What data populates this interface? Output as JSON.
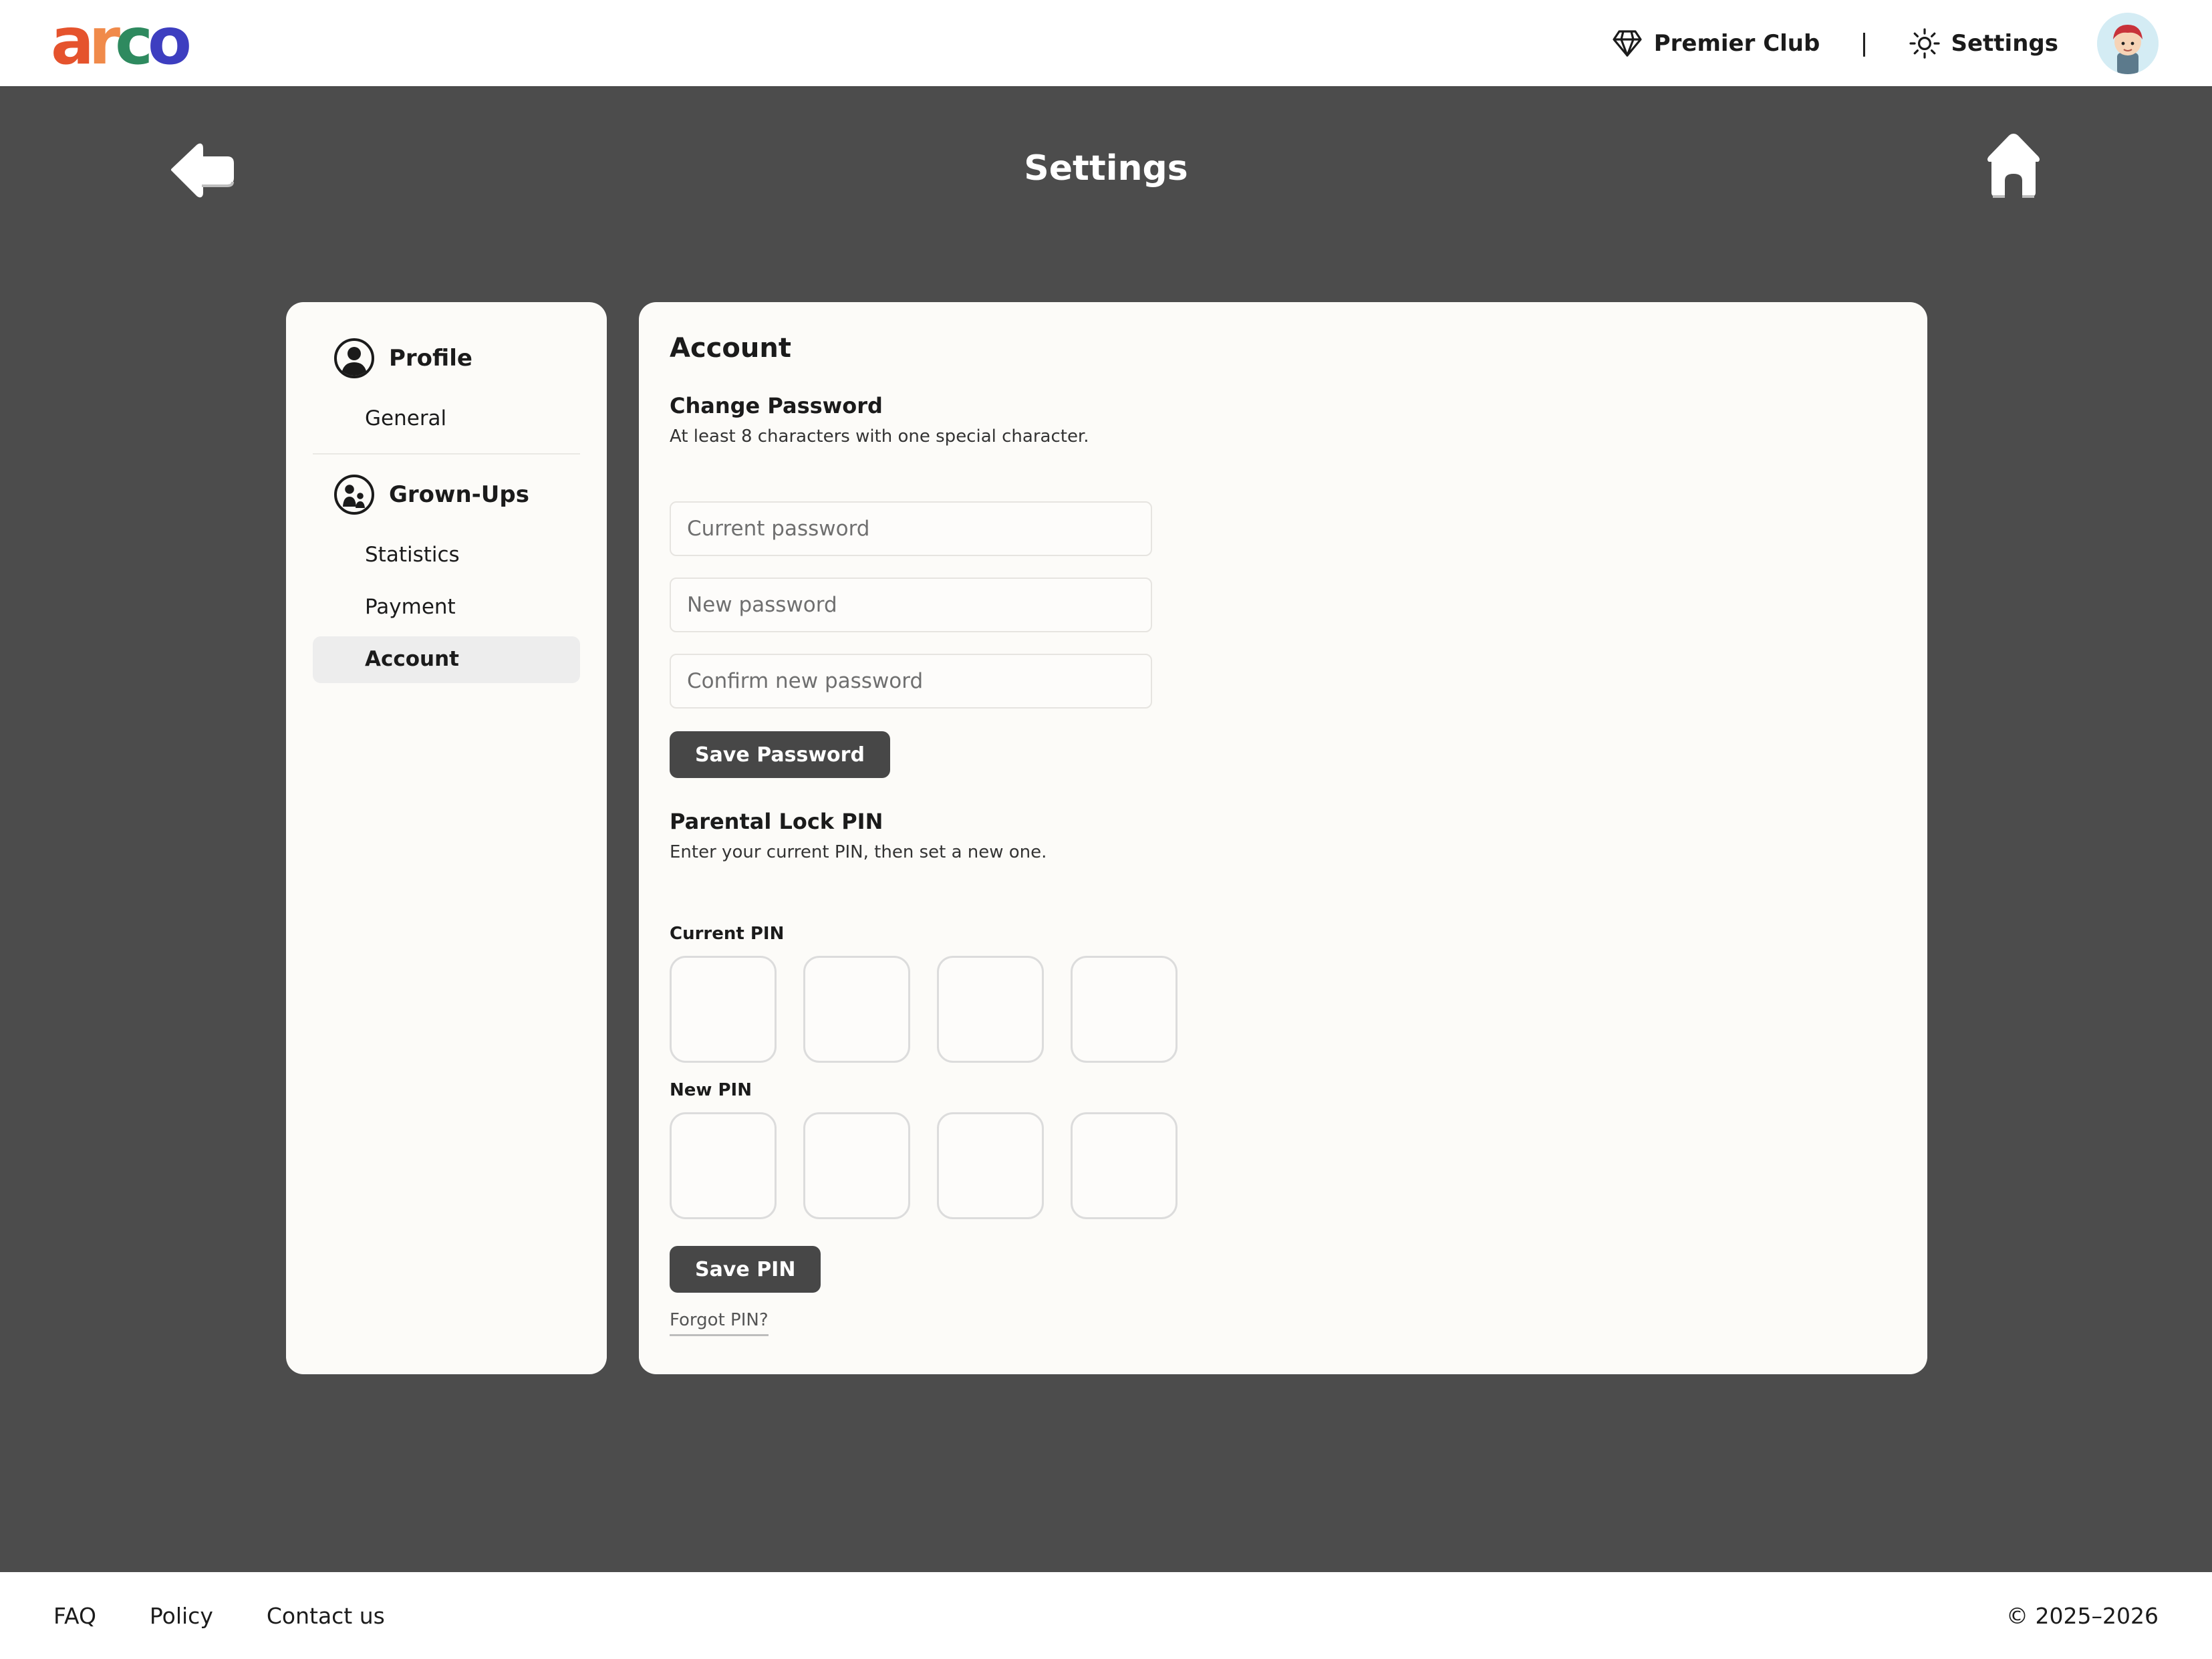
{
  "brand": {
    "logo_letters": [
      {
        "char": "a",
        "color": "#e5532d"
      },
      {
        "char": "r",
        "color": "#f08a4a"
      },
      {
        "char": "c",
        "color": "#2e8a5f"
      },
      {
        "char": "o",
        "color": "#3d3ec0"
      }
    ]
  },
  "topnav": {
    "premier_label": "Premier Club",
    "separator": "|",
    "settings_label": "Settings",
    "premier_icon": "diamond-icon",
    "settings_icon": "gear-icon"
  },
  "page": {
    "title": "Settings"
  },
  "sidebar": {
    "groups": [
      {
        "label": "Profile",
        "icon": "user-circle-icon",
        "items": [
          "General"
        ]
      },
      {
        "label": "Grown-Ups",
        "icon": "family-icon",
        "items": [
          "Statistics",
          "Payment",
          "Account"
        ]
      }
    ],
    "active_item": "Account"
  },
  "account": {
    "heading": "Account",
    "change_password": {
      "title": "Change Password",
      "description": "At least 8 characters with one special character.",
      "current_placeholder": "Current password",
      "new_placeholder": "New password",
      "confirm_placeholder": "Confirm new password",
      "save_label": "Save Password"
    },
    "pin": {
      "title": "Parental Lock PIN",
      "description": "Enter your current PIN, then set a new one.",
      "current_label": "Current PIN",
      "new_label": "New PIN",
      "save_label": "Save PIN",
      "forgot_label": "Forgot PIN?"
    }
  },
  "footer": {
    "links": [
      "FAQ",
      "Policy",
      "Contact us"
    ],
    "copyright": "© 2025–2026"
  }
}
